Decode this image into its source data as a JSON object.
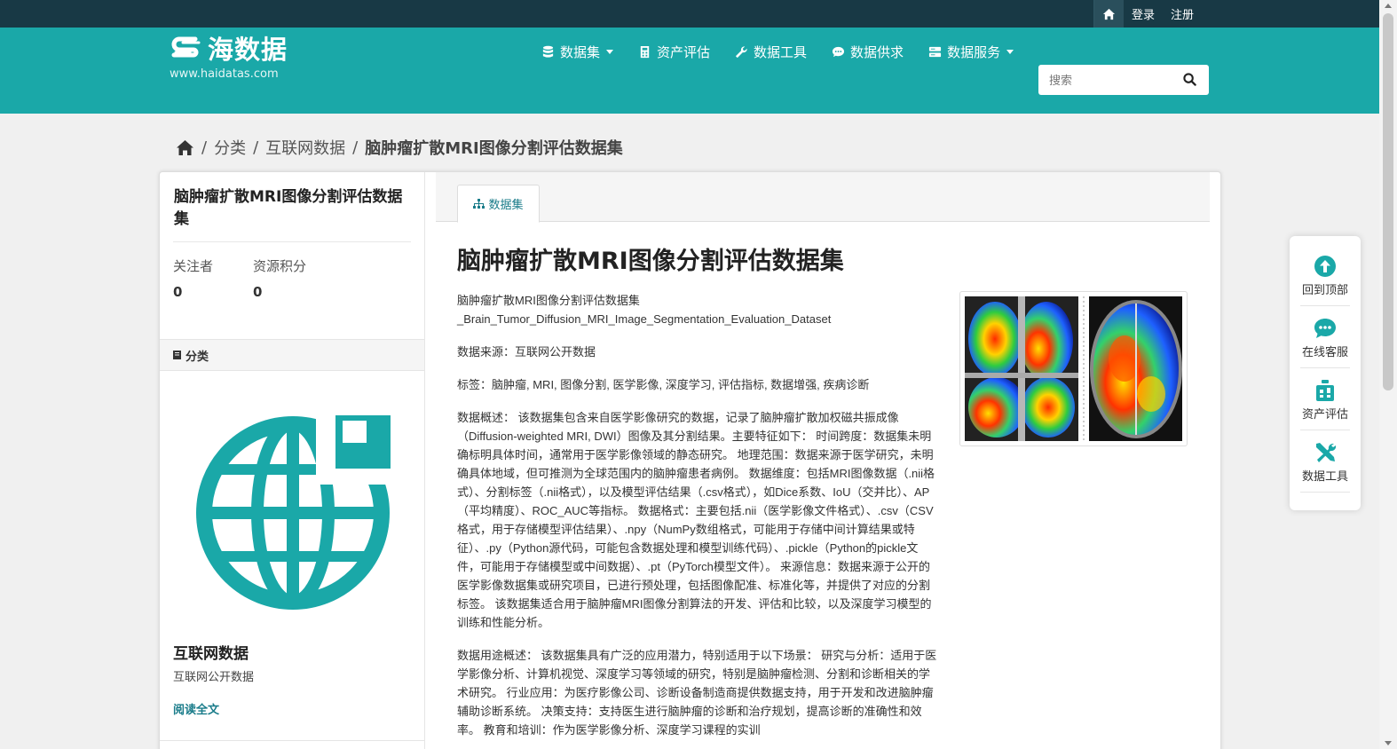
{
  "topbar": {
    "login": "登录",
    "register": "注册"
  },
  "brand": {
    "name": "海数据",
    "url": "www.haidatas.com"
  },
  "nav": [
    {
      "label": "数据集",
      "icon": "database-icon",
      "dropdown": true
    },
    {
      "label": "资产评估",
      "icon": "calculator-icon",
      "dropdown": false
    },
    {
      "label": "数据工具",
      "icon": "wrench-icon",
      "dropdown": false
    },
    {
      "label": "数据供求",
      "icon": "chat-icon",
      "dropdown": false
    },
    {
      "label": "数据服务",
      "icon": "server-icon",
      "dropdown": true
    }
  ],
  "search": {
    "placeholder": "搜索"
  },
  "breadcrumb": {
    "items": [
      "分类",
      "互联网数据"
    ],
    "current": "脑肿瘤扩散MRI图像分割评估数据集"
  },
  "sidebar": {
    "title": "脑肿瘤扩散MRI图像分割评估数据集",
    "stats": [
      {
        "label": "关注者",
        "value": "0"
      },
      {
        "label": "资源积分",
        "value": "0"
      }
    ],
    "category_header": "分类",
    "category_name": "互联网数据",
    "category_desc": "互联网公开数据",
    "read_more": "阅读全文"
  },
  "main": {
    "tab": "数据集",
    "title": "脑肿瘤扩散MRI图像分割评估数据集",
    "name_cn": "脑肿瘤扩散MRI图像分割评估数据集",
    "name_en": "_Brain_Tumor_Diffusion_MRI_Image_Segmentation_Evaluation_Dataset",
    "source": "数据来源：互联网公开数据",
    "tags": "标签：脑肿瘤, MRI, 图像分割, 医学影像, 深度学习, 评估指标, 数据增强, 疾病诊断",
    "overview": "数据概述： 该数据集包含来自医学影像研究的数据，记录了脑肿瘤扩散加权磁共振成像（Diffusion-weighted MRI, DWI）图像及其分割结果。主要特征如下： 时间跨度：数据集未明确标明具体时间，通常用于医学影像领域的静态研究。 地理范围：数据来源于医学研究，未明确具体地域，但可推测为全球范围内的脑肿瘤患者病例。 数据维度：包括MRI图像数据（.nii格式）、分割标签（.nii格式），以及模型评估结果（.csv格式），如Dice系数、IoU（交并比）、AP（平均精度）、ROC_AUC等指标。 数据格式：主要包括.nii（医学影像文件格式）、.csv（CSV格式，用于存储模型评估结果）、.npy（NumPy数组格式，可能用于存储中间计算结果或特征）、.py（Python源代码，可能包含数据处理和模型训练代码）、.pickle（Python的pickle文件，可能用于存储模型或中间数据）、.pt（PyTorch模型文件）。 来源信息：数据来源于公开的医学影像数据集或研究项目，已进行预处理，包括图像配准、标准化等，并提供了对应的分割标签。 该数据集适合用于脑肿瘤MRI图像分割算法的开发、评估和比较，以及深度学习模型的训练和性能分析。",
    "usage": "数据用途概述： 该数据集具有广泛的应用潜力，特别适用于以下场景： 研究与分析：适用于医学影像分析、计算机视觉、深度学习等领域的研究，特别是脑肿瘤检测、分割和诊断相关的学术研究。 行业应用：为医疗影像公司、诊断设备制造商提供数据支持，用于开发和改进脑肿瘤辅助诊断系统。 决策支持：支持医生进行脑肿瘤的诊断和治疗规划，提高诊断的准确性和效率。 教育和培训：作为医学影像分析、深度学习课程的实训"
  },
  "float_panel": [
    {
      "label": "回到顶部",
      "icon": "arrow-up-circle-icon"
    },
    {
      "label": "在线客服",
      "icon": "chat-bubble-icon"
    },
    {
      "label": "资产评估",
      "icon": "assessment-icon"
    },
    {
      "label": "数据工具",
      "icon": "tools-icon"
    }
  ],
  "colors": {
    "teal": "#1aa8a8",
    "topbar": "#183945",
    "link": "#1a7c8a"
  }
}
